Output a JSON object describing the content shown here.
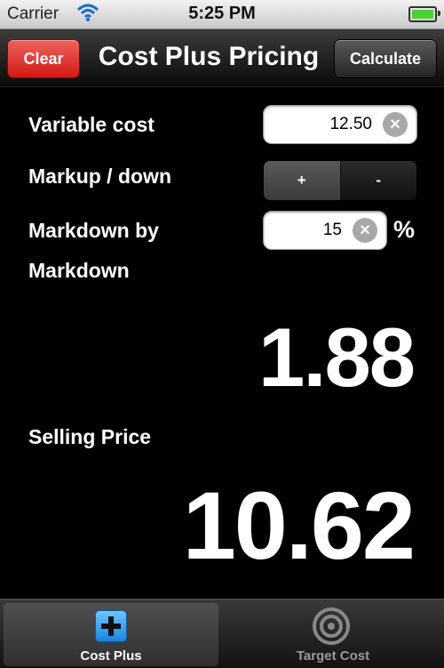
{
  "status_bar": {
    "carrier": "Carrier",
    "time": "5:25 PM"
  },
  "nav": {
    "clear_label": "Clear",
    "title": "Cost Plus Pricing",
    "calculate_label": "Calculate"
  },
  "form": {
    "variable_cost_label": "Variable cost",
    "variable_cost_value": "12.50",
    "markup_label": "Markup / down",
    "markup_options": [
      "+",
      "-"
    ],
    "markup_selected": "+",
    "markdown_label": "Markdown by",
    "markdown_value": "15",
    "markdown_unit": "%"
  },
  "results": {
    "markdown_label": "Markdown",
    "markdown_value": "1.88",
    "selling_price_label": "Selling Price",
    "selling_price_value": "10.62"
  },
  "tab_bar": {
    "tabs": [
      {
        "label": "Cost Plus",
        "icon": "plus-icon",
        "active": true
      },
      {
        "label": "Target Cost",
        "icon": "target-icon",
        "active": false
      }
    ]
  },
  "colors": {
    "clear_button": "#d11a14",
    "background": "#000000",
    "active_tab_icon": "#1a84df"
  }
}
